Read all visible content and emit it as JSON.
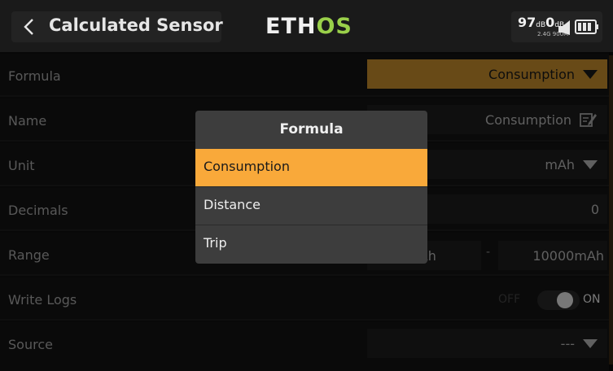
{
  "header": {
    "title": "Calculated Sensor",
    "logo_prefix": "ETH",
    "logo_suffix": "OS",
    "rssi_1": "97",
    "rssi_1_unit": "dB",
    "rssi_2": "0",
    "rssi_2_unit": "dB",
    "rssi_sub": "2.4G 900M",
    "icons": [
      "back-arrow-icon",
      "signal-icon",
      "battery-icon"
    ]
  },
  "rows": {
    "formula": {
      "label": "Formula",
      "value": "Consumption"
    },
    "name": {
      "label": "Name",
      "value": "Consumption"
    },
    "unit": {
      "label": "Unit",
      "value": "mAh"
    },
    "decimals": {
      "label": "Decimals",
      "value": "0"
    },
    "range": {
      "label": "Range",
      "min": "0mAh",
      "separator": "-",
      "max": "10000mAh"
    },
    "write_logs": {
      "label": "Write Logs",
      "off_label": "OFF",
      "on_label": "ON",
      "state": "ON"
    },
    "source": {
      "label": "Source",
      "value": "---"
    }
  },
  "popup": {
    "title": "Formula",
    "options": [
      "Consumption",
      "Distance",
      "Trip"
    ],
    "selected": "Consumption"
  },
  "colors": {
    "accent": "#f9a93a",
    "accent_dim": "#c78f2d",
    "logo_green": "#9ad04a",
    "background": "#111111"
  }
}
